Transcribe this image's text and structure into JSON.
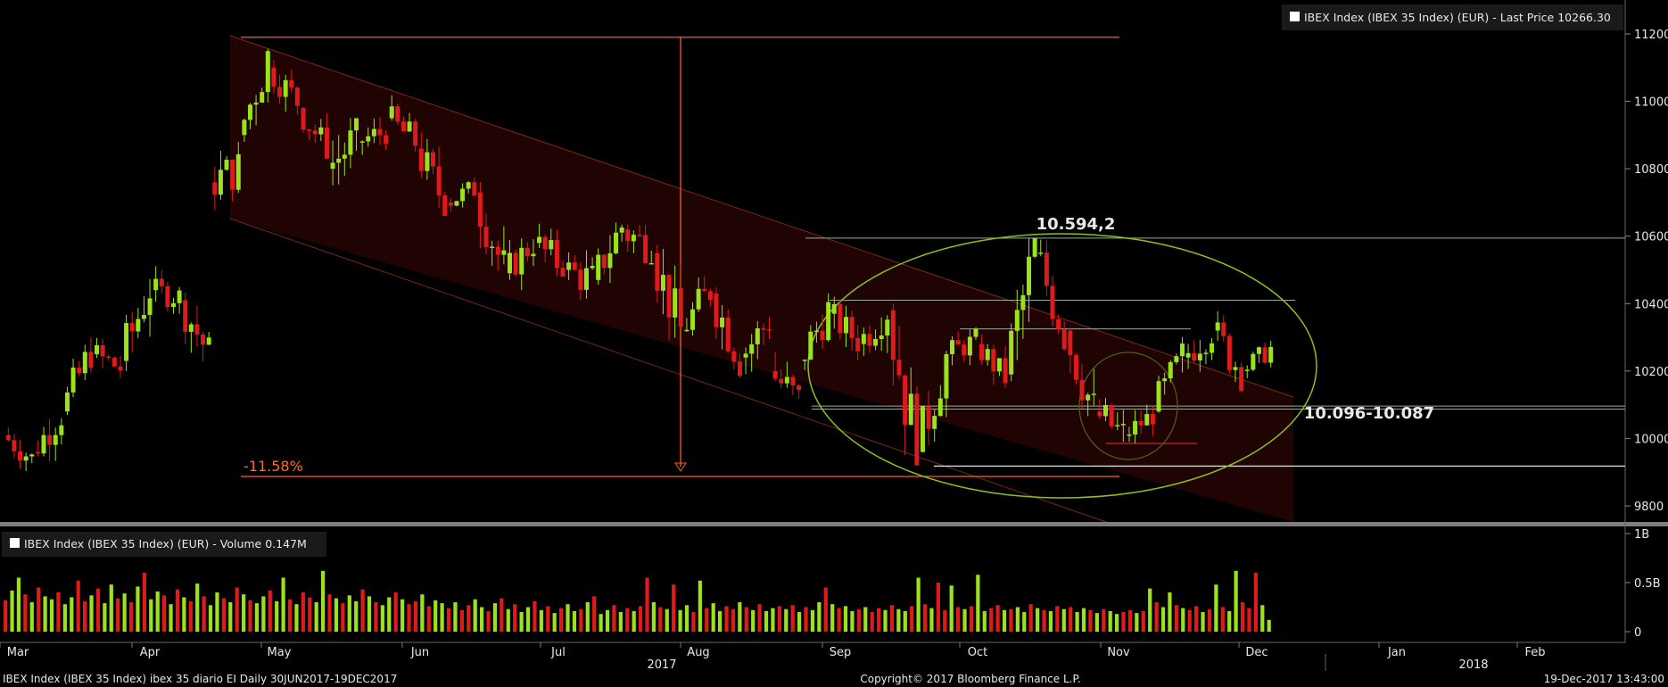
{
  "header": {
    "price_legend": "IBEX Index (IBEX 35 Index) (EUR) - Last Price  10266.30",
    "volume_legend": "IBEX Index (IBEX 35 Index) (EUR) - Volume 0.147M"
  },
  "footer": {
    "left": "IBEX Index (IBEX 35 Index) ibex 35 diario EI  Daily 30JUN2017-19DEC2017",
    "center": "Copyright© 2017 Bloomberg Finance L.P.",
    "right": "19-Dec-2017 13:43:00"
  },
  "colors": {
    "up": "#9be21b",
    "down": "#e01a1a",
    "channel": "#ff5a2a",
    "ellipse": "#8fbf1a",
    "hline": "#9aa89a"
  },
  "chart_data": [
    {
      "type": "candlestick",
      "title": "IBEX Index (IBEX 35 Index) (EUR) - Last Price  10266.30",
      "y_ticks": [
        "11200",
        "11000",
        "10800",
        "10600",
        "10400",
        "10200",
        "10000",
        "9800"
      ],
      "ylim": [
        9760,
        11240
      ],
      "x_ticks": [
        "Mar",
        "Apr",
        "May",
        "Jun",
        "Jul",
        "Aug",
        "Sep",
        "Oct",
        "Nov",
        "Dec",
        "Jan",
        "Feb"
      ],
      "year_labels": [
        "2017",
        "2018"
      ],
      "last_price": 10266.3,
      "annotations": {
        "high_label": "10.594,2",
        "support_label": "10.096-10.087",
        "drop_label": "-11.58%"
      },
      "levels": {
        "top": 11190,
        "low": 9890,
        "high_oct": 10594.2,
        "support_upper": 10096,
        "support_lower": 10087,
        "nov_low": 9918,
        "range_top": 10410
      },
      "series": [
        {
          "date": "Mar 01",
          "values": [
            10010,
            10060,
            9900,
            9940
          ]
        },
        {
          "date": "Mar 08",
          "values": [
            9960,
            10120,
            9920,
            10070
          ]
        },
        {
          "date": "Mar 15",
          "values": [
            10080,
            10300,
            10060,
            10260
          ]
        },
        {
          "date": "Mar 22",
          "values": [
            10250,
            10360,
            10180,
            10210
          ]
        },
        {
          "date": "Mar 29",
          "values": [
            10230,
            10500,
            10200,
            10450
          ]
        },
        {
          "date": "Apr 05",
          "values": [
            10440,
            10530,
            10370,
            10420
          ]
        },
        {
          "date": "Apr 12",
          "values": [
            10410,
            10470,
            10220,
            10250
          ]
        },
        {
          "date": "Apr 19",
          "values": [
            10760,
            10880,
            10620,
            10800
          ]
        },
        {
          "date": "Apr 26",
          "values": [
            10900,
            11190,
            10880,
            11130
          ]
        },
        {
          "date": "May 03",
          "values": [
            11100,
            11150,
            10960,
            11000
          ]
        },
        {
          "date": "May 10",
          "values": [
            10980,
            11020,
            10830,
            10860
          ]
        },
        {
          "date": "May 17",
          "values": [
            10800,
            10950,
            10660,
            10890
          ]
        },
        {
          "date": "May 24",
          "values": [
            10880,
            11000,
            10840,
            10910
          ]
        },
        {
          "date": "May 31",
          "values": [
            10950,
            11050,
            10850,
            10880
          ]
        },
        {
          "date": "Jun 07",
          "values": [
            10860,
            10920,
            10660,
            10700
          ]
        },
        {
          "date": "Jun 14",
          "values": [
            10700,
            10800,
            10660,
            10740
          ]
        },
        {
          "date": "Jun 21",
          "values": [
            10730,
            10760,
            10460,
            10500
          ]
        },
        {
          "date": "Jun 28",
          "values": [
            10490,
            10620,
            10430,
            10580
          ]
        },
        {
          "date": "Jul 05",
          "values": [
            10580,
            10700,
            10480,
            10510
          ]
        },
        {
          "date": "Jul 12",
          "values": [
            10500,
            10640,
            10410,
            10470
          ]
        },
        {
          "date": "Jul 19",
          "values": [
            10470,
            10660,
            10440,
            10630
          ]
        },
        {
          "date": "Jul 26",
          "values": [
            10620,
            10760,
            10520,
            10560
          ]
        },
        {
          "date": "Aug 02",
          "values": [
            10550,
            10600,
            10280,
            10320
          ]
        },
        {
          "date": "Aug 09",
          "values": [
            10320,
            10480,
            10250,
            10440
          ]
        },
        {
          "date": "Aug 16",
          "values": [
            10430,
            10460,
            10180,
            10240
          ]
        },
        {
          "date": "Aug 23",
          "values": [
            10240,
            10380,
            10140,
            10350
          ]
        },
        {
          "date": "Aug 30",
          "values": [
            10200,
            10340,
            10080,
            10110
          ]
        },
        {
          "date": "Sep 06",
          "values": [
            10230,
            10430,
            10190,
            10380
          ]
        },
        {
          "date": "Sep 13",
          "values": [
            10370,
            10420,
            10230,
            10290
          ]
        },
        {
          "date": "Sep 20",
          "values": [
            10280,
            10420,
            10200,
            10380
          ]
        },
        {
          "date": "Sep 27",
          "values": [
            10380,
            10400,
            9920,
            9960
          ]
        },
        {
          "date": "Oct 04",
          "values": [
            9960,
            10260,
            9940,
            10240
          ]
        },
        {
          "date": "Oct 11",
          "values": [
            10250,
            10330,
            10180,
            10290
          ]
        },
        {
          "date": "Oct 18",
          "values": [
            10280,
            10320,
            10150,
            10180
          ]
        },
        {
          "date": "Oct 25",
          "values": [
            10190,
            10594,
            10170,
            10560
          ]
        },
        {
          "date": "Nov 01",
          "values": [
            10550,
            10590,
            10260,
            10320
          ]
        },
        {
          "date": "Nov 08",
          "values": [
            10320,
            10360,
            10050,
            10080
          ]
        },
        {
          "date": "Nov 15",
          "values": [
            10080,
            10120,
            9890,
            10010
          ]
        },
        {
          "date": "Nov 22",
          "values": [
            10010,
            10100,
            9960,
            10070
          ]
        },
        {
          "date": "Nov 29",
          "values": [
            10080,
            10300,
            10060,
            10240
          ]
        },
        {
          "date": "Dec 06",
          "values": [
            10240,
            10360,
            10160,
            10320
          ]
        },
        {
          "date": "Dec 13",
          "values": [
            10320,
            10380,
            10140,
            10200
          ]
        },
        {
          "date": "Dec 19",
          "values": [
            10200,
            10290,
            10160,
            10266
          ]
        }
      ]
    },
    {
      "type": "bar",
      "title": "IBEX Index (IBEX 35 Index) (EUR) - Volume 0.147M",
      "y_ticks": [
        "1B",
        "0.5B",
        "0"
      ],
      "ylim": [
        0,
        1
      ],
      "values": [
        0.32,
        0.42,
        0.55,
        0.38,
        0.3,
        0.45,
        0.36,
        0.33,
        0.4,
        0.28,
        0.35,
        0.52,
        0.31,
        0.37,
        0.44,
        0.29,
        0.48,
        0.34,
        0.39,
        0.3,
        0.46,
        0.6,
        0.33,
        0.41,
        0.37,
        0.28,
        0.43,
        0.35,
        0.31,
        0.49,
        0.36,
        0.27,
        0.4,
        0.34,
        0.3,
        0.45,
        0.38,
        0.32,
        0.29,
        0.36,
        0.42,
        0.31,
        0.55,
        0.33,
        0.28,
        0.4,
        0.35,
        0.3,
        0.62,
        0.38,
        0.34,
        0.29,
        0.37,
        0.31,
        0.43,
        0.36,
        0.3,
        0.27,
        0.35,
        0.4,
        0.33,
        0.28,
        0.31,
        0.38,
        0.26,
        0.32,
        0.29,
        0.24,
        0.3,
        0.22,
        0.27,
        0.33,
        0.25,
        0.21,
        0.29,
        0.34,
        0.23,
        0.28,
        0.2,
        0.25,
        0.31,
        0.22,
        0.26,
        0.19,
        0.24,
        0.28,
        0.21,
        0.23,
        0.3,
        0.36,
        0.18,
        0.22,
        0.27,
        0.2,
        0.24,
        0.21,
        0.26,
        0.55,
        0.3,
        0.25,
        0.23,
        0.48,
        0.22,
        0.27,
        0.2,
        0.52,
        0.24,
        0.29,
        0.21,
        0.26,
        0.23,
        0.3,
        0.25,
        0.22,
        0.28,
        0.21,
        0.24,
        0.26,
        0.23,
        0.27,
        0.2,
        0.25,
        0.22,
        0.3,
        0.45,
        0.28,
        0.24,
        0.26,
        0.21,
        0.23,
        0.25,
        0.2,
        0.24,
        0.22,
        0.27,
        0.23,
        0.21,
        0.26,
        0.55,
        0.28,
        0.24,
        0.5,
        0.22,
        0.47,
        0.25,
        0.23,
        0.26,
        0.58,
        0.21,
        0.24,
        0.27,
        0.22,
        0.23,
        0.25,
        0.2,
        0.28,
        0.24,
        0.22,
        0.21,
        0.26,
        0.23,
        0.25,
        0.2,
        0.24,
        0.22,
        0.19,
        0.23,
        0.21,
        0.18,
        0.2,
        0.22,
        0.19,
        0.21,
        0.44,
        0.3,
        0.25,
        0.4,
        0.27,
        0.24,
        0.22,
        0.26,
        0.2,
        0.23,
        0.48,
        0.25,
        0.21,
        0.62,
        0.3,
        0.24,
        0.6,
        0.27,
        0.12
      ],
      "colors_up": [
        0,
        1,
        1,
        0,
        1,
        0,
        1,
        1,
        0,
        1,
        1,
        0,
        0,
        1,
        0,
        1,
        1,
        0,
        1,
        0,
        1,
        0,
        1,
        1,
        0,
        1,
        0,
        1,
        0,
        1,
        0,
        1,
        1,
        0,
        1,
        0,
        1,
        0,
        1,
        1,
        0,
        1,
        1,
        0,
        1,
        0,
        0,
        1,
        1,
        0,
        1,
        0,
        1,
        1,
        0,
        1,
        0,
        1,
        1,
        0,
        1,
        0,
        0,
        1,
        0,
        1,
        1,
        0,
        1,
        0,
        0,
        1,
        1,
        0,
        1,
        0,
        1,
        0,
        1,
        1,
        0,
        1,
        0,
        1,
        0,
        1,
        1,
        0,
        1,
        0,
        1,
        1,
        0,
        1,
        0,
        1,
        0,
        0,
        1,
        0,
        1,
        0,
        1,
        1,
        0,
        1,
        0,
        1,
        1,
        0,
        0,
        1,
        0,
        1,
        0,
        1,
        1,
        0,
        1,
        0,
        1,
        0,
        1,
        1,
        0,
        1,
        0,
        1,
        1,
        0,
        1,
        0,
        0,
        1,
        0,
        1,
        1,
        0,
        1,
        0,
        1,
        0,
        0,
        1,
        0,
        1,
        0,
        1,
        1,
        0,
        0,
        1,
        0,
        1,
        1,
        0,
        1,
        0,
        1,
        0,
        1,
        0,
        1,
        1,
        0,
        1,
        0,
        1,
        1,
        0,
        0,
        1,
        0,
        1,
        0,
        1,
        1,
        0,
        1,
        0,
        0,
        1,
        0,
        1,
        0,
        1,
        1,
        0,
        0,
        0,
        1,
        1
      ]
    }
  ]
}
